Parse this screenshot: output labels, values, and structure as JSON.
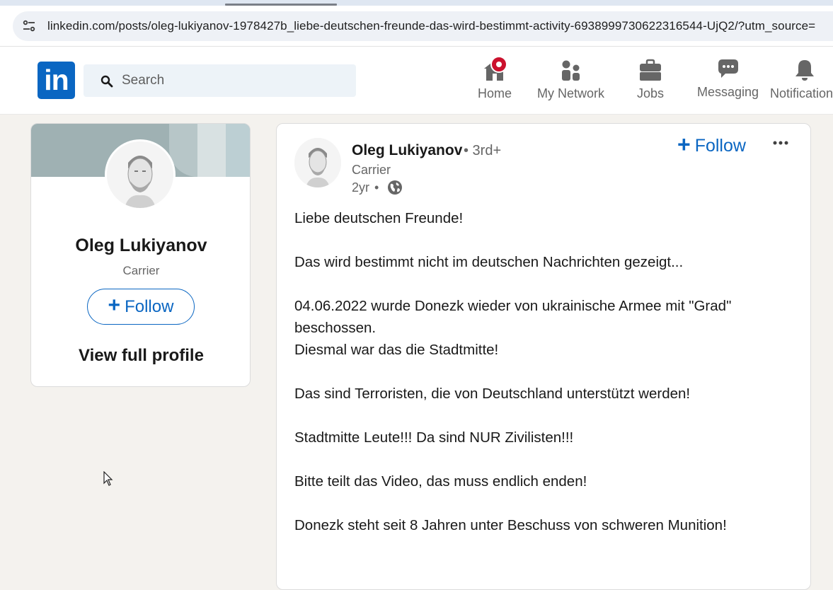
{
  "browser": {
    "url": "linkedin.com/posts/oleg-lukiyanov-1978427b_liebe-deutschen-freunde-das-wird-bestimmt-activity-6938999730622316544-UjQ2/?utm_source="
  },
  "header": {
    "logo_text": "in",
    "search_placeholder": "Search",
    "nav": [
      {
        "label": "Home",
        "icon": "home-icon"
      },
      {
        "label": "My Network",
        "icon": "network-icon"
      },
      {
        "label": "Jobs",
        "icon": "briefcase-icon"
      },
      {
        "label": "Messaging",
        "icon": "messaging-icon"
      },
      {
        "label": "Notifications",
        "icon": "bell-icon"
      }
    ]
  },
  "profile_card": {
    "name": "Oleg Lukiyanov",
    "role": "Carrier",
    "follow_label": "Follow",
    "view_profile_label": "View full profile"
  },
  "post": {
    "author": "Oleg Lukiyanov",
    "degree": "• 3rd+",
    "role": "Carrier",
    "time": "2yr",
    "time_separator": "•",
    "follow_label": "Follow",
    "body": [
      "Liebe deutschen Freunde!",
      "",
      "Das wird bestimmt nicht im deutschen Nachrichten gezeigt...",
      "",
      "04.06.2022 wurde Donezk wieder von ukrainische Armee mit \"Grad\" beschossen.",
      "Diesmal war das die Stadtmitte!",
      "",
      "Das sind Terroristen, die von Deutschland unterstützt werden!",
      "",
      "Stadtmitte Leute!!! Da sind NUR Zivilisten!!!",
      "",
      "Bitte teilt das Video, das muss endlich enden!",
      "",
      "Donezk steht seit 8 Jahren unter Beschuss von schweren Munition!"
    ]
  },
  "colors": {
    "brand": "#0a66c2",
    "badge": "#cb112d",
    "page_bg": "#f4f2ee"
  }
}
